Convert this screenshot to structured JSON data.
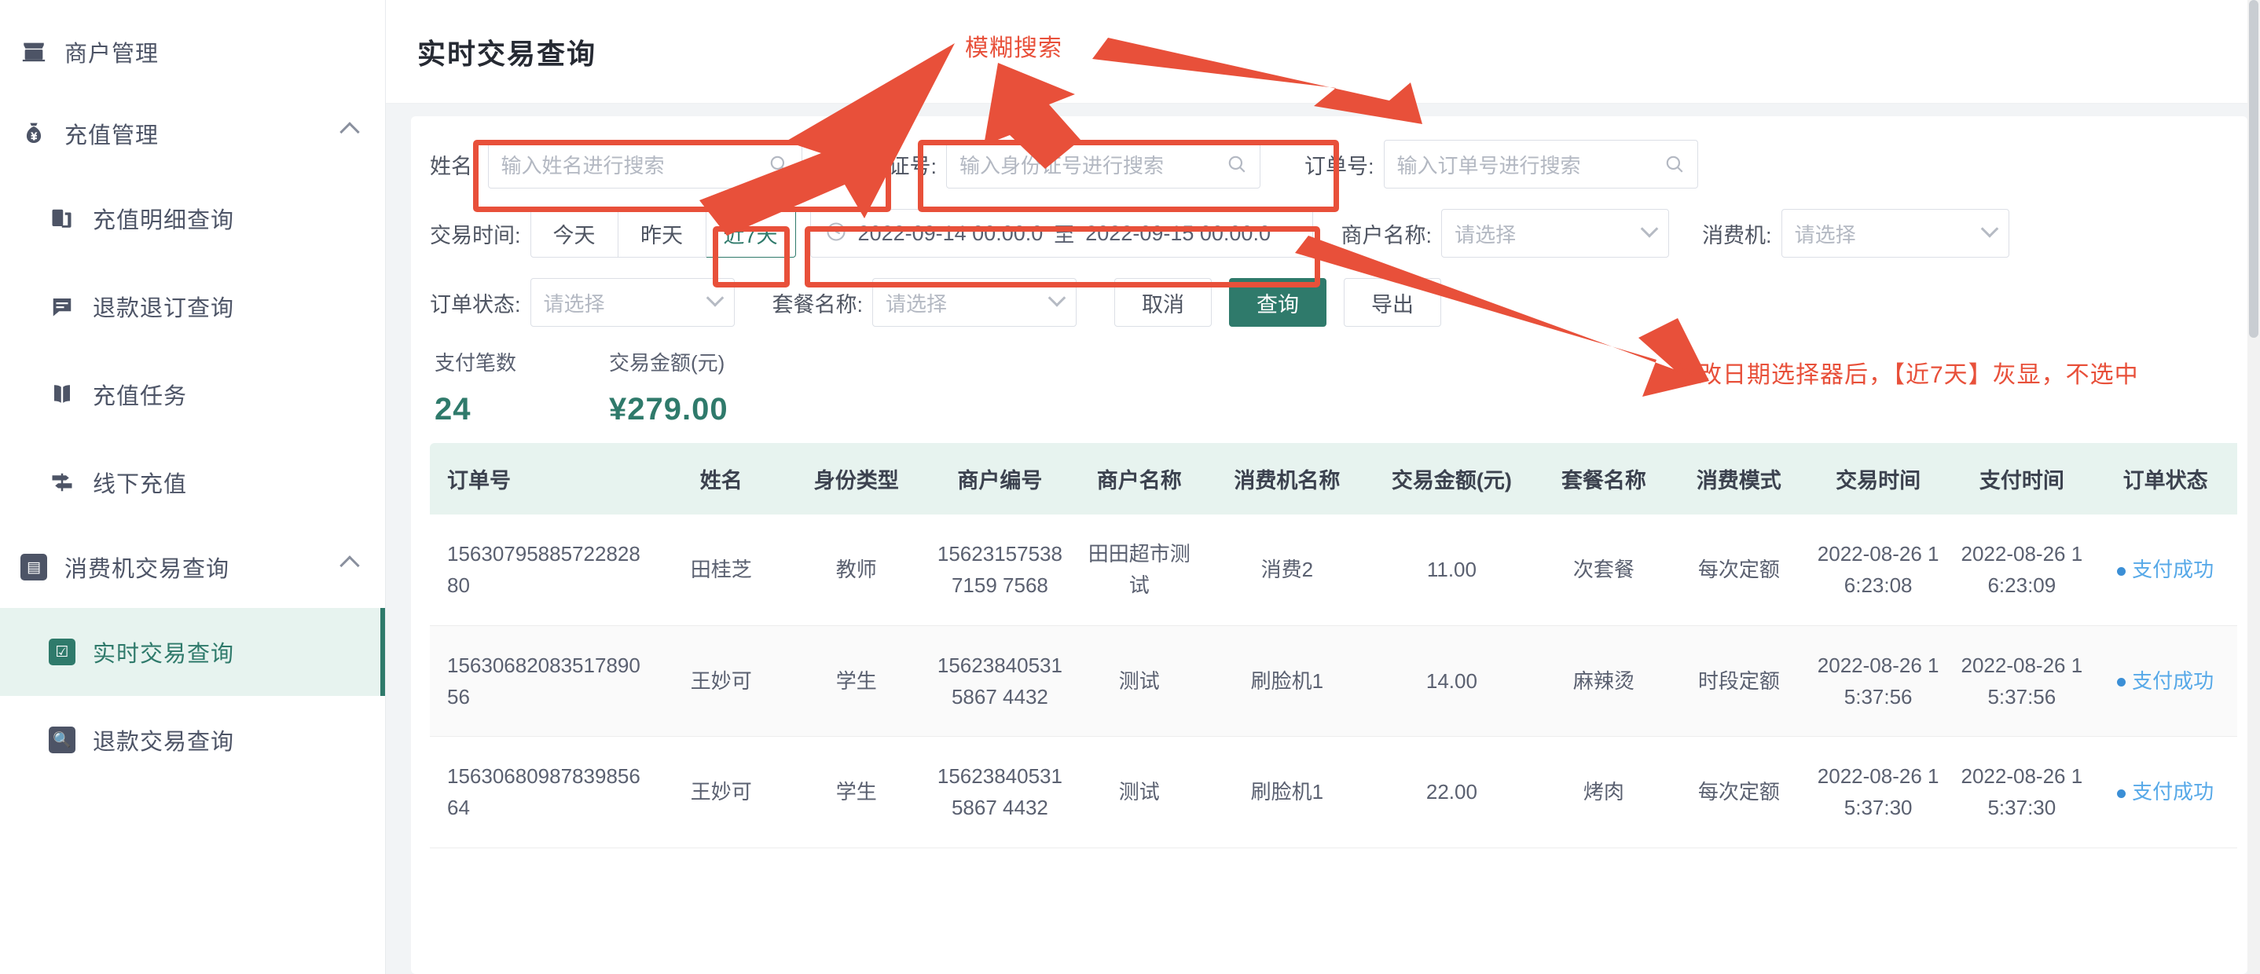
{
  "sidebar": {
    "groups": [
      {
        "label": "商户管理",
        "icon": "store-icon",
        "collapsible": false,
        "items": []
      },
      {
        "label": "充值管理",
        "icon": "money-bag-icon",
        "collapsible": true,
        "chevron": "chevron-up-icon",
        "items": [
          {
            "label": "充值明细查询",
            "icon": "documents-icon",
            "active": false
          },
          {
            "label": "退款退订查询",
            "icon": "message-icon",
            "active": false
          },
          {
            "label": "充值任务",
            "icon": "book-icon",
            "active": false
          },
          {
            "label": "线下充值",
            "icon": "signpost-icon",
            "active": false
          }
        ]
      },
      {
        "label": "消费机交易查询",
        "icon": "monitor-icon",
        "collapsible": true,
        "chevron": "chevron-up-icon",
        "items": [
          {
            "label": "实时交易查询",
            "icon": "clipboard-check-icon",
            "active": true
          },
          {
            "label": "退款交易查询",
            "icon": "search-box-icon",
            "active": false
          }
        ]
      }
    ]
  },
  "header": {
    "title": "实时交易查询"
  },
  "search_form": {
    "name_label": "姓名:",
    "name_placeholder": "输入姓名进行搜索",
    "id_label": "身份证号:",
    "id_placeholder": "输入身份证号进行搜索",
    "order_label": "订单号:",
    "order_placeholder": "输入订单号进行搜索",
    "time_label": "交易时间:",
    "quick_ranges": [
      {
        "label": "今天",
        "selected": false
      },
      {
        "label": "昨天",
        "selected": false
      },
      {
        "label": "近7天",
        "selected": true
      }
    ],
    "date_start": "2022-09-14 00:00:0",
    "date_sep": "至",
    "date_end": "2022-09-15 00:00:0",
    "merchant_label": "商户名称:",
    "merchant_placeholder": "请选择",
    "device_label": "消费机:",
    "device_placeholder": "请选择",
    "order_status_label": "订单状态:",
    "order_status_placeholder": "请选择",
    "meal_label": "套餐名称:",
    "meal_placeholder": "请选择",
    "cancel_label": "取消",
    "query_label": "查询",
    "export_label": "导出"
  },
  "stats": [
    {
      "title": "支付笔数",
      "value": "24"
    },
    {
      "title": "交易金额(元)",
      "value": "¥279.00"
    }
  ],
  "table": {
    "columns": [
      "订单号",
      "姓名",
      "身份类型",
      "商户编号",
      "商户名称",
      "消费机名称",
      "交易金额(元)",
      "套餐名称",
      "消费模式",
      "交易时间",
      "支付时间",
      "订单状态"
    ],
    "rows": [
      {
        "order_no": "1563079588572282880",
        "name": "田桂芝",
        "identity_type": "教师",
        "merchant_no": "156231575387159 7568",
        "merchant_name": "田田超市测试",
        "device_name": "消费2",
        "amount": "11.00",
        "meal_name": "次套餐",
        "mode": "每次定额",
        "trade_time": "2022-08-26 16:23:08",
        "pay_time": "2022-08-26 16:23:09",
        "status": "支付成功"
      },
      {
        "order_no": "1563068208351789056",
        "name": "王妙可",
        "identity_type": "学生",
        "merchant_no": "156238405315867 4432",
        "merchant_name": "测试",
        "device_name": "刷脸机1",
        "amount": "14.00",
        "meal_name": "麻辣烫",
        "mode": "时段定额",
        "trade_time": "2022-08-26 15:37:56",
        "pay_time": "2022-08-26 15:37:56",
        "status": "支付成功"
      },
      {
        "order_no": "1563068098783985664",
        "name": "王妙可",
        "identity_type": "学生",
        "merchant_no": "156238405315867 4432",
        "merchant_name": "测试",
        "device_name": "刷脸机1",
        "amount": "22.00",
        "meal_name": "烤肉",
        "mode": "每次定额",
        "trade_time": "2022-08-26 15:37:30",
        "pay_time": "2022-08-26 15:37:30",
        "status": "支付成功"
      }
    ]
  },
  "annotations": [
    {
      "id": "fuzzy-search",
      "text": "模糊搜索"
    },
    {
      "id": "date-picker-note",
      "text": "修改日期选择器后，【近7天】灰显，不选中"
    }
  ],
  "colors": {
    "accent": "#2f7a6b",
    "accent_light": "#e7f3ef",
    "annotation_red": "#e8503a",
    "status_blue": "#57a9e8"
  }
}
